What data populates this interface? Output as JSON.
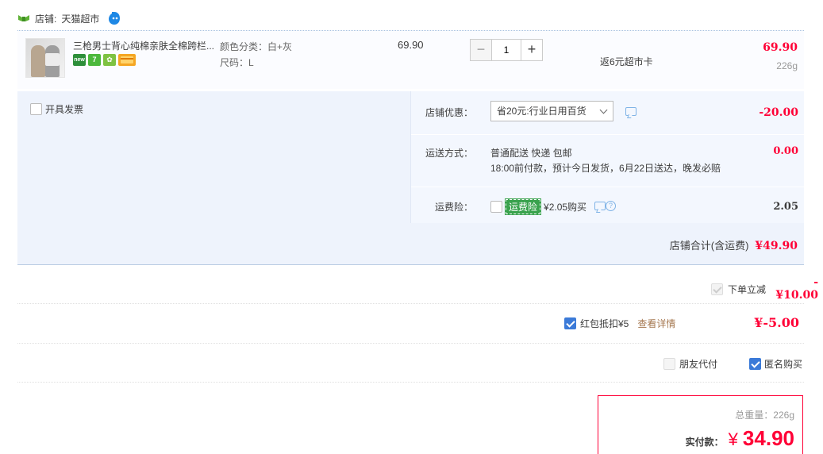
{
  "shop": {
    "label": "店铺:",
    "name": "天猫超市"
  },
  "item": {
    "title": "三枪男士背心纯棉亲肤全棉跨栏...",
    "badges": [
      "new",
      "7",
      "✿"
    ],
    "sku_color": "颜色分类：白+灰",
    "sku_size": "尺码：L",
    "unit_price": "69.90",
    "quantity": "1",
    "qty_minus": "−",
    "qty_plus": "+",
    "rebate": "返6元超市卡",
    "total": "69.90",
    "weight": "226g"
  },
  "invoice": {
    "label": "开具发票"
  },
  "shop_discount": {
    "label": "店铺优惠：",
    "selected": "省20元:行业日用百货",
    "amount": "-20.00"
  },
  "shipping": {
    "label": "运送方式：",
    "method": "普通配送 快递 包邮",
    "note": "18:00前付款，预计今日发货，6月22日送达，晚发必赔",
    "amount": "0.00"
  },
  "insurance": {
    "label": "运费险：",
    "tag": "运费险",
    "price": "¥2.05购买",
    "amount": "2.05"
  },
  "shop_total": {
    "label": "店铺合计(含运费)",
    "amount": "¥49.90"
  },
  "order_discount": {
    "label": "下单立减",
    "amount": "-¥10.00"
  },
  "red_packet": {
    "label": "红包抵扣¥5",
    "link": "查看详情",
    "amount": "¥-5.00"
  },
  "options": {
    "friend_pay": "朋友代付",
    "anonymous": "匿名购买"
  },
  "summary": {
    "weight_label": "总重量：",
    "weight": "226g",
    "pay_label": "实付款：",
    "currency": "¥",
    "amount": "34.90"
  },
  "colors": {
    "accent_red": "#ff0036",
    "checkbox_blue": "#3b7ad8",
    "service_bg": "#eef3fc"
  }
}
